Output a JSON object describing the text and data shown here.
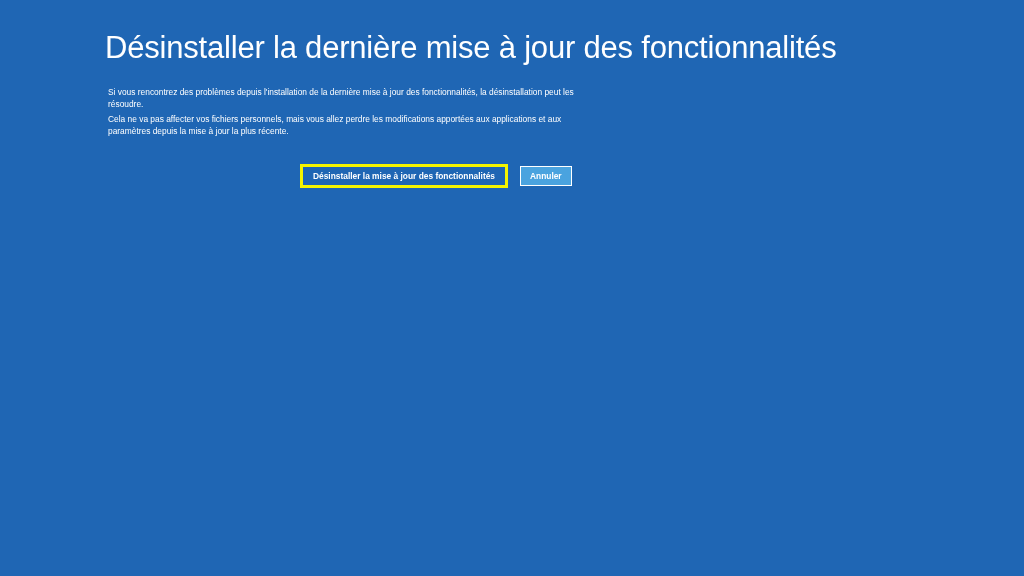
{
  "title": "Désinstaller la dernière mise à jour des fonctionnalités",
  "paragraphs": [
    "Si vous rencontrez des problèmes depuis l'installation de la dernière mise à jour des fonctionnalités, la désinstallation peut les résoudre.",
    "Cela ne va pas affecter vos fichiers personnels, mais vous allez perdre les modifications apportées aux applications et aux paramètres depuis la mise à jour la plus récente."
  ],
  "buttons": [
    {
      "label": "Désinstaller la mise à jour des fonctionnalités",
      "kind": "primary",
      "focused": true
    },
    {
      "label": "Annuler",
      "kind": "secondary",
      "focused": false
    }
  ]
}
